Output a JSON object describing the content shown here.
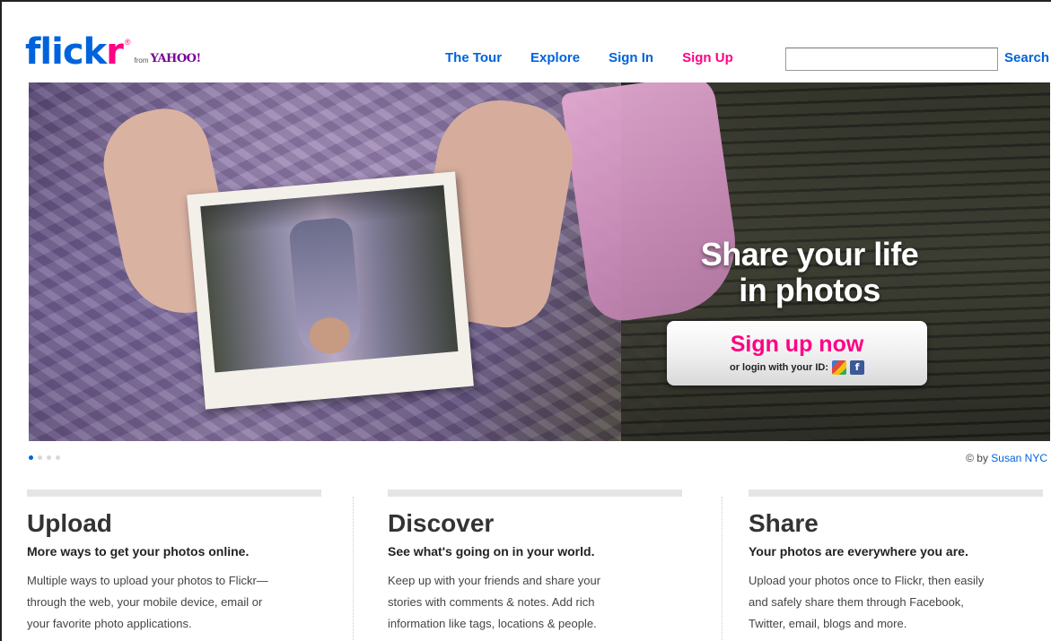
{
  "header": {
    "logo": {
      "main": "flick",
      "accent": "r",
      "registered": "®",
      "from": "from",
      "yahoo": "YAHOO!"
    },
    "nav": [
      {
        "label": "The Tour"
      },
      {
        "label": "Explore"
      },
      {
        "label": "Sign In"
      },
      {
        "label": "Sign Up"
      }
    ],
    "search": {
      "value": "",
      "placeholder": "",
      "button_label": "Search"
    }
  },
  "hero": {
    "title_line1": "Share your life",
    "title_line2": "in photos",
    "cta_label": "Sign up now",
    "cta_sub": "or login with your ID:",
    "id_icons": [
      "google-icon",
      "facebook-icon"
    ],
    "google_glyph": "",
    "facebook_glyph": "f"
  },
  "carousel": {
    "count": 4,
    "active_index": 0
  },
  "credit": {
    "prefix": "© by",
    "author": "Susan NYC"
  },
  "columns": [
    {
      "title": "Upload",
      "subtitle": "More ways to get your photos online.",
      "lines": [
        "Multiple ways to upload your photos to Flickr—",
        "through the web, your mobile device, email or",
        "your favorite photo applications."
      ]
    },
    {
      "title": "Discover",
      "subtitle": "See what's going on in your world.",
      "lines": [
        "Keep up with your friends and share your",
        "stories with comments & notes. Add rich",
        "information like tags, locations & people."
      ]
    },
    {
      "title": "Share",
      "subtitle": "Your photos are everywhere you are.",
      "lines": [
        "Upload your photos once to Flickr, then easily",
        "and safely share them through Facebook,",
        "Twitter, email, blogs and more."
      ]
    }
  ],
  "colors": {
    "brand_blue": "#0063dc",
    "brand_pink": "#ff0084"
  }
}
